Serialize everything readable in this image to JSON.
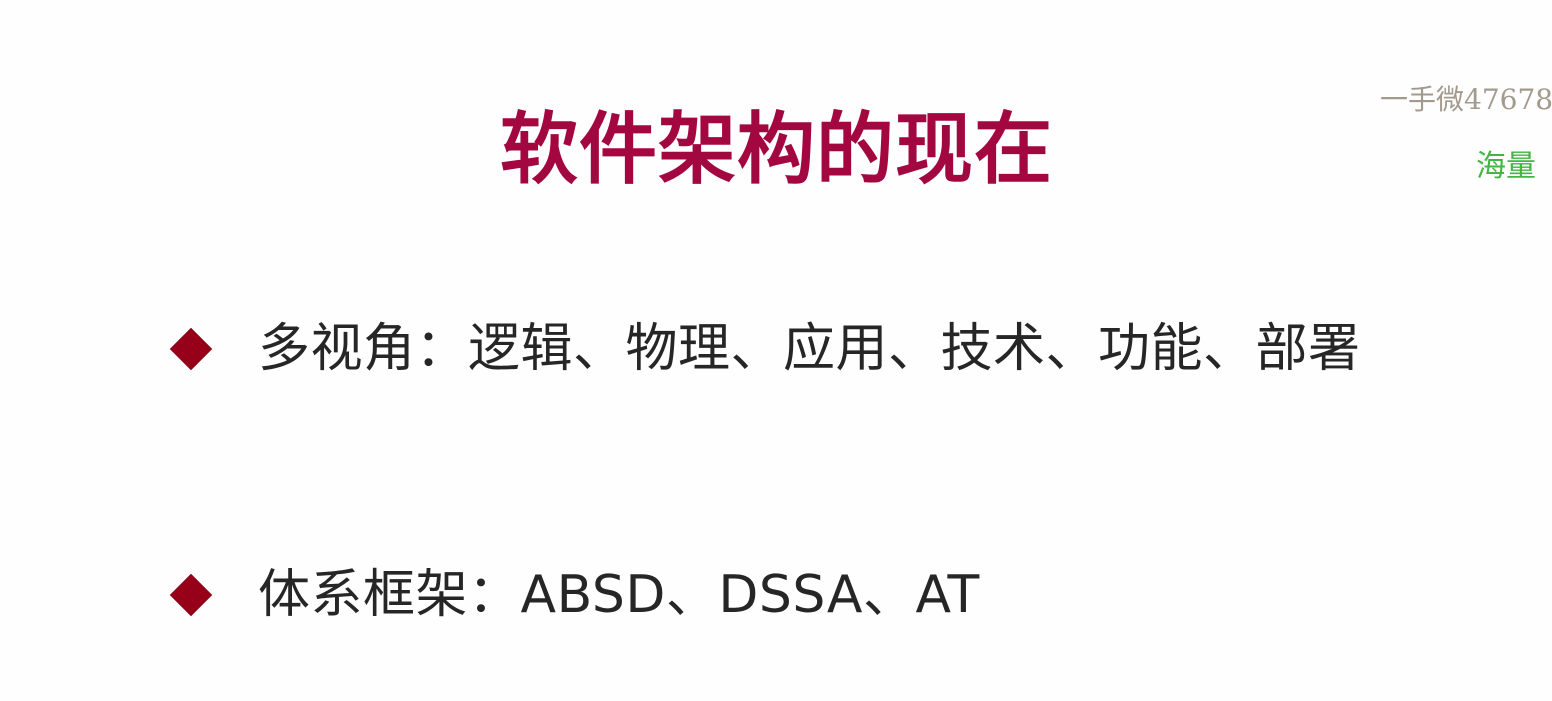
{
  "slide": {
    "title": "软件架构的现在",
    "watermark_contact": "一手微47678",
    "watermark_more": "海量",
    "bullets": [
      {
        "icon": "diamond-bullet-icon",
        "text": "多视角：逻辑、物理、应用、技术、功能、部署"
      },
      {
        "icon": "diamond-bullet-icon",
        "text": "体系框架：ABSD、DSSA、AT"
      }
    ]
  },
  "colors": {
    "title": "#a3073f",
    "bullet_icon": "#960018",
    "body_text": "#262626",
    "watermark_gray": "#a39a8e",
    "watermark_green": "#42b542"
  }
}
